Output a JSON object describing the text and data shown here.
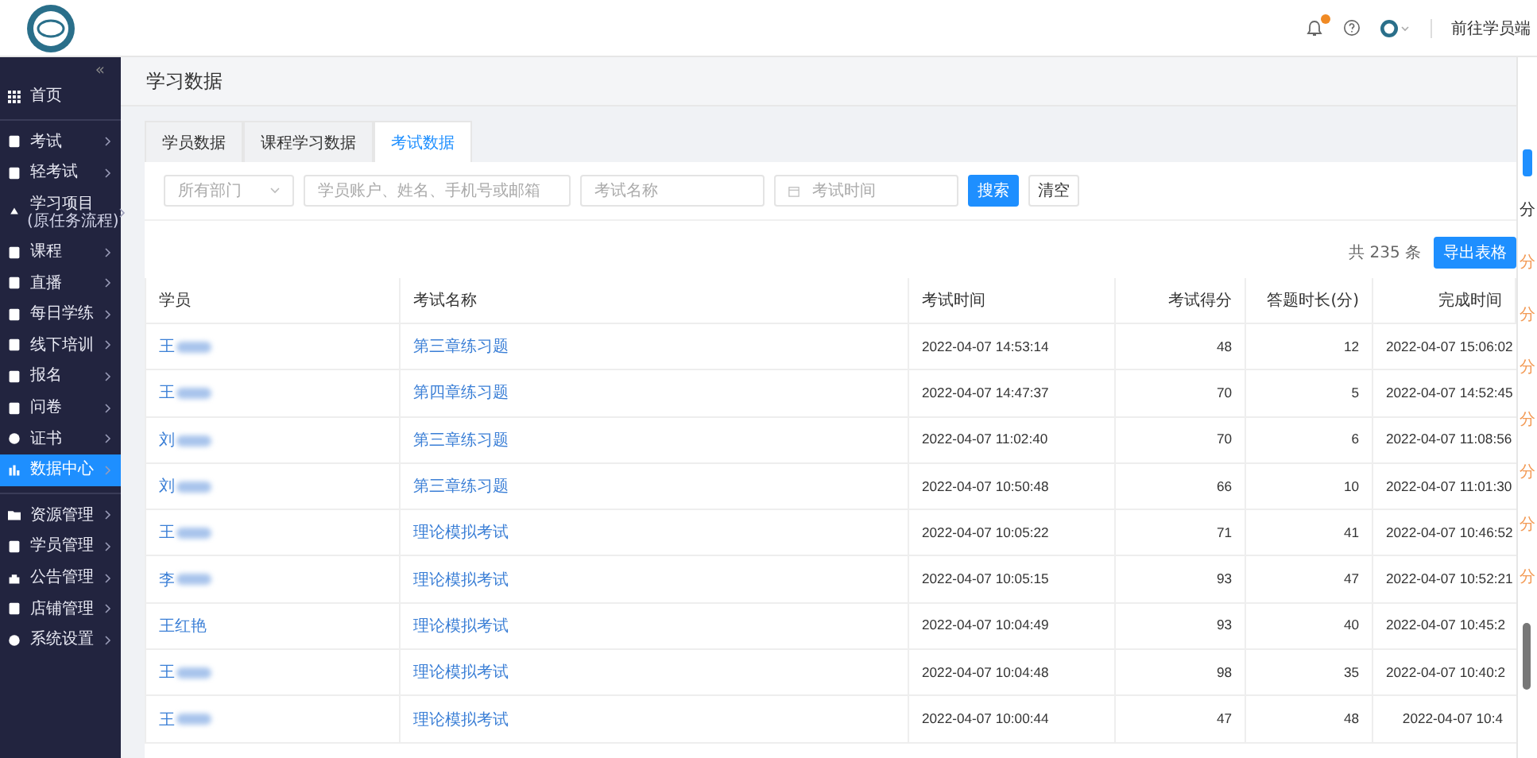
{
  "header": {
    "bell_badge": true,
    "link": "前往学员端"
  },
  "sidebar": {
    "collapse": "«",
    "groups": [
      {
        "items": [
          {
            "label": "首页",
            "selected": false,
            "arrow": false
          }
        ]
      },
      {
        "items": [
          {
            "label": "考试",
            "selected": false,
            "arrow": true
          },
          {
            "label": "轻考试",
            "selected": false,
            "arrow": true
          },
          {
            "label": "学习项目",
            "sub": "(原任务流程)",
            "selected": false,
            "arrow": true
          },
          {
            "label": "课程",
            "selected": false,
            "arrow": true
          },
          {
            "label": "直播",
            "selected": false,
            "arrow": true
          },
          {
            "label": "每日学练",
            "selected": false,
            "arrow": true
          },
          {
            "label": "线下培训",
            "selected": false,
            "arrow": true
          },
          {
            "label": "报名",
            "selected": false,
            "arrow": true
          },
          {
            "label": "问卷",
            "selected": false,
            "arrow": true
          },
          {
            "label": "证书",
            "selected": false,
            "arrow": true
          },
          {
            "label": "数据中心",
            "selected": true,
            "arrow": true
          }
        ]
      },
      {
        "items": [
          {
            "label": "资源管理",
            "selected": false,
            "arrow": true
          },
          {
            "label": "学员管理",
            "selected": false,
            "arrow": true
          },
          {
            "label": "公告管理",
            "selected": false,
            "arrow": true
          },
          {
            "label": "店铺管理",
            "selected": false,
            "arrow": true
          },
          {
            "label": "系统设置",
            "selected": false,
            "arrow": true
          }
        ]
      }
    ]
  },
  "page_title": "学习数据",
  "tabs": [
    {
      "label": "学员数据",
      "selected": false
    },
    {
      "label": "课程学习数据",
      "selected": false
    },
    {
      "label": "考试数据",
      "selected": true
    }
  ],
  "filters": {
    "department": {
      "placeholder": "所有部门"
    },
    "student": {
      "placeholder": "学员账户、姓名、手机号或邮箱"
    },
    "exam": {
      "placeholder": "考试名称"
    },
    "time": {
      "placeholder": "考试时间"
    },
    "search": "搜索",
    "clear": "清空"
  },
  "total": {
    "prefix": "共",
    "count": "235",
    "suffix": "条"
  },
  "export": "导出表格",
  "table": {
    "columns": [
      "学员",
      "考试名称",
      "考试时间",
      "考试得分",
      "答题时长(分)",
      "完成时间"
    ],
    "rows": [
      {
        "student": "王",
        "blurred": true,
        "exam": "第三章练习题",
        "time": "2022-04-07 14:53:14",
        "score": "48",
        "duration": "12",
        "finish": "2022-04-07 15:06:02"
      },
      {
        "student": "王",
        "blurred": true,
        "exam": "第四章练习题",
        "time": "2022-04-07 14:47:37",
        "score": "70",
        "duration": "5",
        "finish": "2022-04-07 14:52:45"
      },
      {
        "student": "刘",
        "blurred": true,
        "exam": "第三章练习题",
        "time": "2022-04-07 11:02:40",
        "score": "70",
        "duration": "6",
        "finish": "2022-04-07 11:08:56"
      },
      {
        "student": "刘",
        "blurred": true,
        "exam": "第三章练习题",
        "time": "2022-04-07 10:50:48",
        "score": "66",
        "duration": "10",
        "finish": "2022-04-07 11:01:30"
      },
      {
        "student": "王",
        "blurred": true,
        "exam": "理论模拟考试",
        "time": "2022-04-07 10:05:22",
        "score": "71",
        "duration": "41",
        "finish": "2022-04-07 10:46:52"
      },
      {
        "student": "李",
        "blurred": true,
        "exam": "理论模拟考试",
        "time": "2022-04-07 10:05:15",
        "score": "93",
        "duration": "47",
        "finish": "2022-04-07 10:52:21"
      },
      {
        "student": "王红艳",
        "blurred": false,
        "exam": "理论模拟考试",
        "time": "2022-04-07 10:04:49",
        "score": "93",
        "duration": "40",
        "finish": "2022-04-07 10:45:2"
      },
      {
        "student": "王",
        "blurred": true,
        "exam": "理论模拟考试",
        "time": "2022-04-07 10:04:48",
        "score": "98",
        "duration": "35",
        "finish": "2022-04-07 10:40:2"
      },
      {
        "student": "王",
        "blurred": true,
        "exam": "理论模拟考试",
        "time": "2022-04-07 10:00:44",
        "score": "47",
        "duration": "48",
        "finish": "2022-04-07 10:4"
      }
    ]
  },
  "side_panel": {
    "header": "分",
    "marks": [
      "分",
      "分",
      "分",
      "分",
      "分",
      "分",
      "分"
    ]
  }
}
